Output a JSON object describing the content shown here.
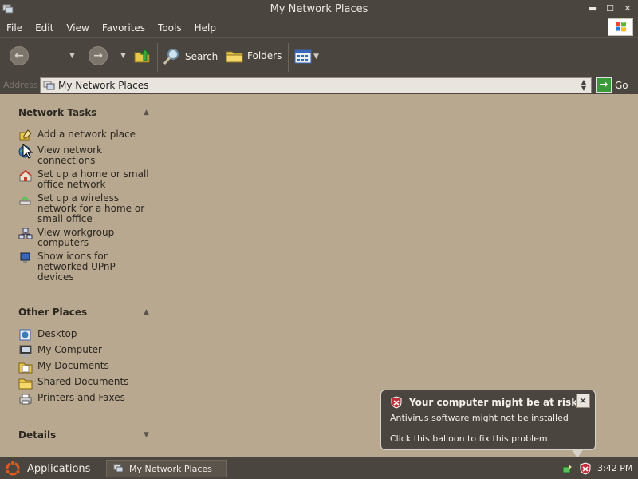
{
  "window": {
    "title": "My Network Places"
  },
  "menu": [
    "File",
    "Edit",
    "View",
    "Favorites",
    "Tools",
    "Help"
  ],
  "toolbar": {
    "search_label": "Search",
    "folders_label": "Folders"
  },
  "address": {
    "label": "Address",
    "value": "My Network Places",
    "go_label": "Go"
  },
  "network_tasks": {
    "title": "Network Tasks",
    "items": [
      "Add a network place",
      "View network connections",
      "Set up a home or small office network",
      "Set up a wireless network for a home or small office",
      "View workgroup computers",
      "Show icons for networked UPnP devices"
    ]
  },
  "other_places": {
    "title": "Other Places",
    "items": [
      "Desktop",
      "My Computer",
      "My Documents",
      "Shared Documents",
      "Printers and Faxes"
    ]
  },
  "details": {
    "title": "Details"
  },
  "balloon": {
    "title": "Your computer might be at risk",
    "line1": "Antivirus software might not be installed",
    "line2": "Click this balloon to fix this problem."
  },
  "taskbar": {
    "applications_label": "Applications",
    "window_button_label": "My Network Places",
    "clock": "3:42 PM"
  },
  "colors": {
    "chrome": "#4a453e",
    "content_bg": "#b8a890",
    "alert_red": "#c0303a"
  }
}
